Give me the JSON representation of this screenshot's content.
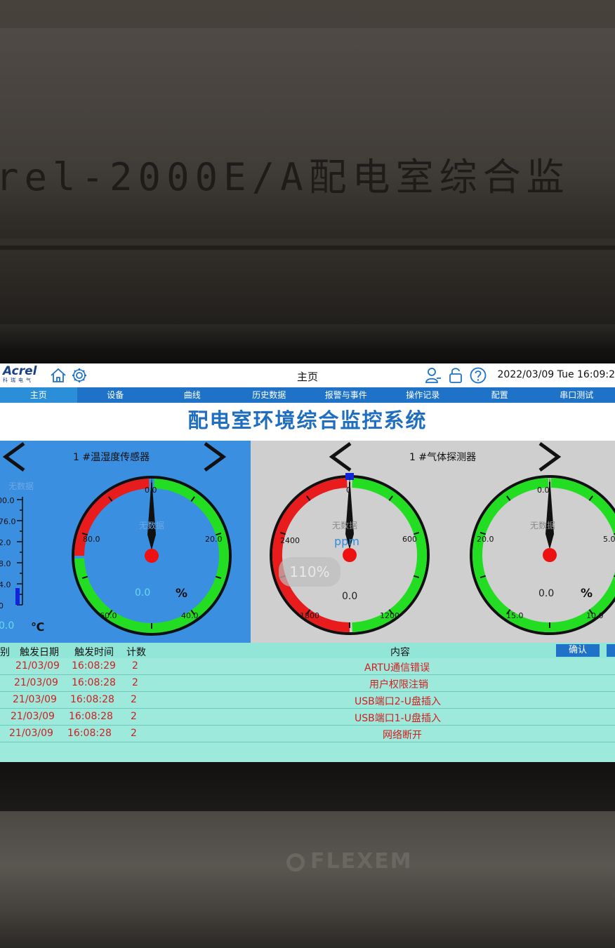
{
  "device": {
    "label": "rel-2000E/A配电室综合监",
    "brand": "FLEXEM"
  },
  "header": {
    "logo": "Acrel",
    "logo_sub": "科瑞电气",
    "page_title": "主页",
    "datetime": "2022/03/09 Tue 16:09:2"
  },
  "nav": {
    "items": [
      "主页",
      "设备",
      "曲线",
      "历史数据",
      "报警与事件",
      "操作记录",
      "配置",
      "串口测试"
    ],
    "active_index": 0
  },
  "main_title": "配电室环境综合监控系统",
  "temp_panel": {
    "title": "1 #温湿度传感器",
    "nodata_left": "无数据",
    "bar_ticks": [
      "00.0",
      "76.0",
      "2.0",
      "8.0",
      "4.0",
      "0"
    ],
    "temp_value": "0.0",
    "temp_unit": "℃",
    "gauge": {
      "nodata": "无数据",
      "ticks": [
        "0.0",
        "20.0",
        "40.0",
        "60.0",
        "80.0"
      ],
      "value": "0.0",
      "unit": "%"
    }
  },
  "gas_panel": {
    "title": "1 #气体探测器",
    "gauge1": {
      "nodata": "无数据",
      "ticks": [
        "0",
        "600",
        "1200",
        "1800",
        "2400"
      ],
      "unit": "ppm",
      "value": "0.0",
      "badge": "110%"
    },
    "gauge2": {
      "nodata": "无数据",
      "ticks": [
        "0.0",
        "5.0",
        "10.0",
        "15.0",
        "20.0"
      ],
      "value": "0.0",
      "unit": "%"
    }
  },
  "events": {
    "headers": {
      "type": "别",
      "date": "触发日期",
      "time": "触发时间",
      "count": "计数",
      "content": "内容"
    },
    "confirm_label": "确认",
    "rows": [
      {
        "date": "21/03/09",
        "time": "16:08:29",
        "count": "2",
        "content": "ARTU通信错误"
      },
      {
        "date": "21/03/09",
        "time": "16:08:28",
        "count": "2",
        "content": "用户权限注销"
      },
      {
        "date": "21/03/09",
        "time": "16:08:28",
        "count": "2",
        "content": "USB端口2-U盘插入"
      },
      {
        "date": "21/03/09",
        "time": "16:08:28",
        "count": "2",
        "content": "USB端口1-U盘插入"
      },
      {
        "date": "21/03/09",
        "time": "16:08:28",
        "count": "2",
        "content": "网络断开"
      }
    ]
  },
  "colors": {
    "nav_bg": "#1e73c8",
    "title_blue": "#1f6ec0",
    "gauge_green": "#22dd22",
    "gauge_red": "#e81c1c",
    "alarm_text": "#d21e1e",
    "event_bg": "#9de9dc"
  }
}
